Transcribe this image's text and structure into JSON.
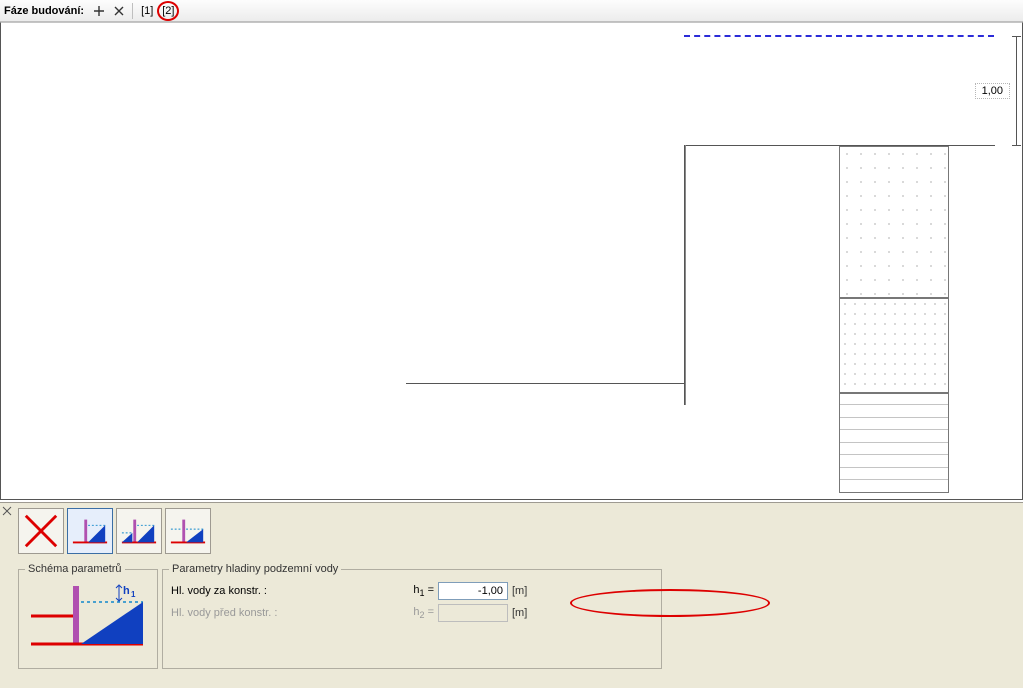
{
  "toolbar": {
    "title": "Fáze budování:",
    "phases": [
      "[1]",
      "[2]"
    ]
  },
  "canvas": {
    "dimension_label": "1,00"
  },
  "groups": {
    "schema_title": "Schéma parametrů",
    "params_title": "Parametry hladiny podzemní vody",
    "schema_h1": "h₁"
  },
  "params": {
    "row1": {
      "label": "Hl. vody za konstr. :",
      "symbol_html": "h<sub>1</sub> =",
      "value": "-1,00",
      "unit": "[m]"
    },
    "row2": {
      "label": "Hl. vody před konstr. :",
      "symbol_html": "h<sub>2</sub> =",
      "value": "",
      "unit": "[m]"
    }
  }
}
